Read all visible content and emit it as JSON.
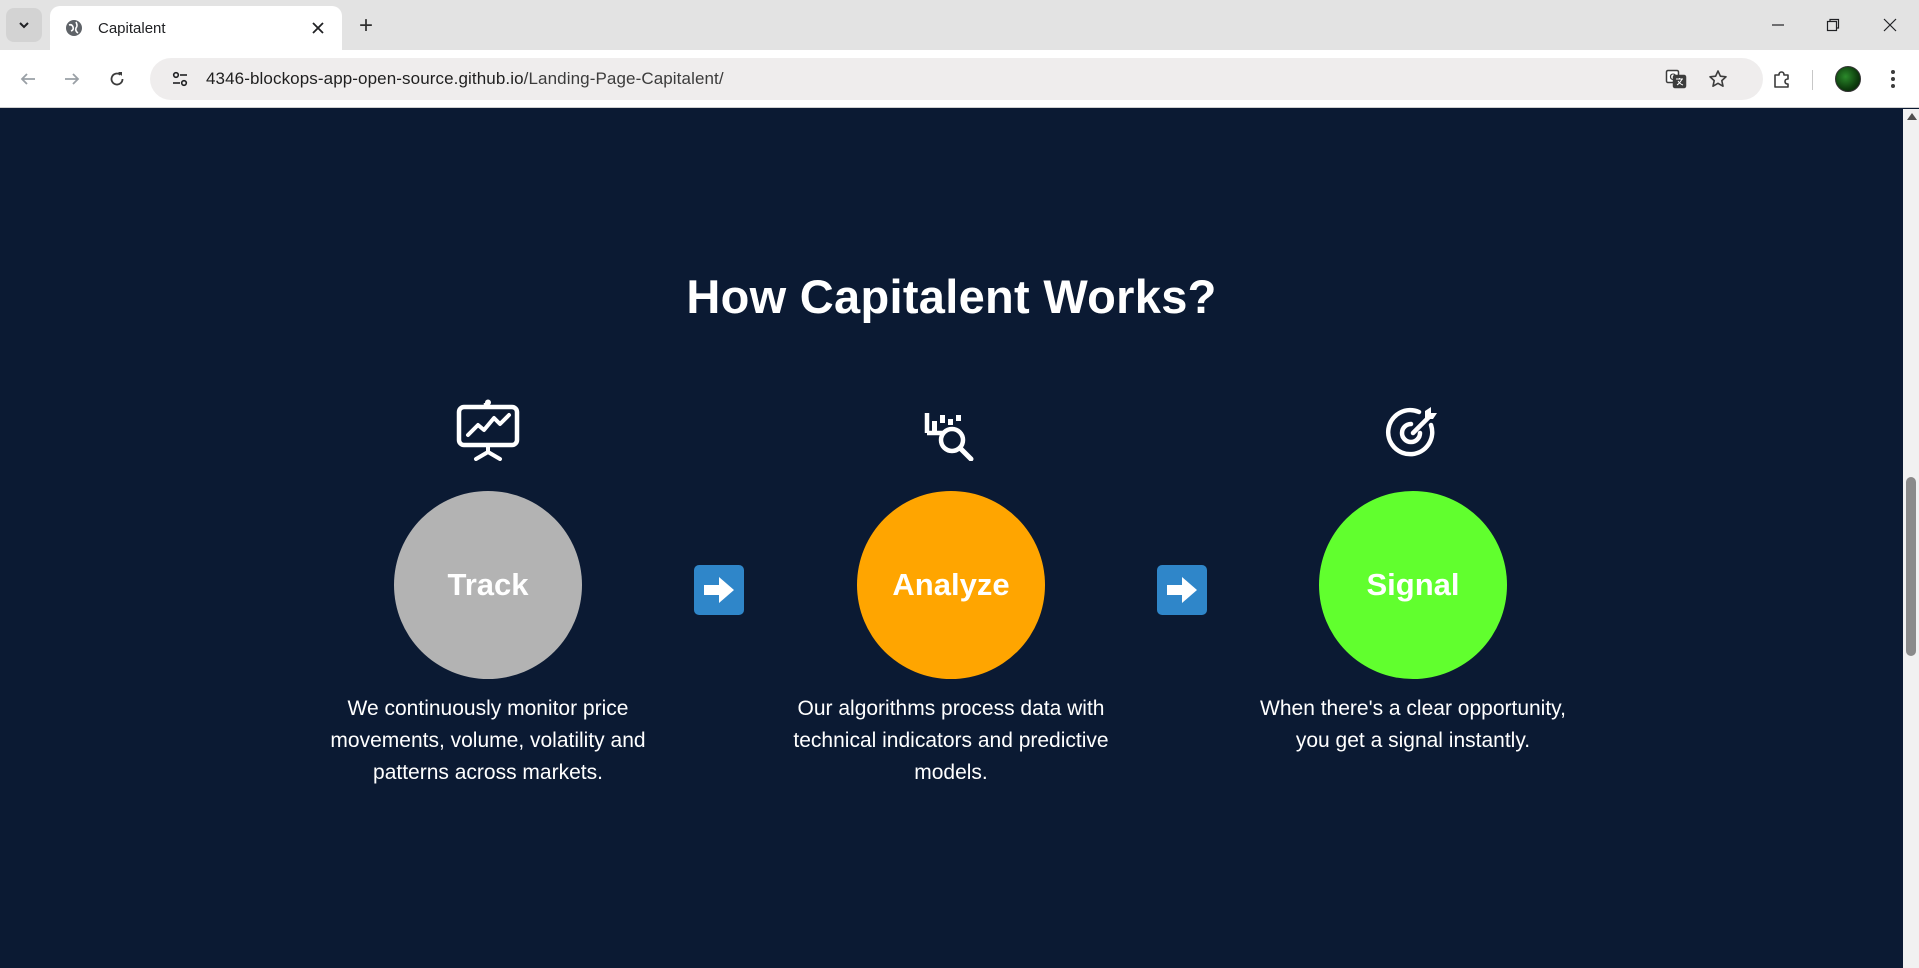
{
  "browser": {
    "tab_title": "Capitalent",
    "new_tab_symbol": "+",
    "url_host": "4346-blockops-app-open-source.github.io",
    "url_path": "/Landing-Page-Capitalent/"
  },
  "page": {
    "section_title": "How Capitalent Works?",
    "steps": [
      {
        "label": "Track",
        "icon": "presentation-chart-icon",
        "color": "#b3b3b3",
        "description": "We continuously monitor price movements, volume, volatility and patterns across markets."
      },
      {
        "label": "Analyze",
        "icon": "chart-search-icon",
        "color": "#ffa500",
        "description": "Our algorithms process data with technical indicators and predictive models."
      },
      {
        "label": "Signal",
        "icon": "target-arrow-icon",
        "color": "#61ff2e",
        "description": "When there's a clear opportunity, you get a signal instantly."
      }
    ],
    "arrow_color": "#2f86c9",
    "background_color": "#0b1a33"
  }
}
